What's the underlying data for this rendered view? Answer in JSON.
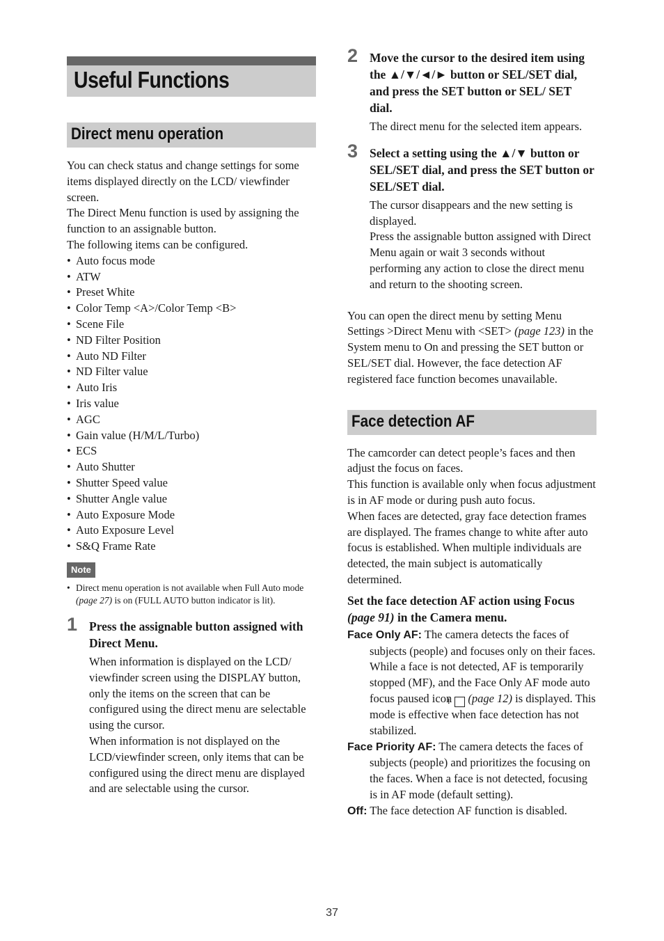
{
  "chapter_title": "Useful Functions",
  "direct_menu": {
    "heading": "Direct menu operation",
    "intro": [
      "You can check status and change settings for some items displayed directly on the LCD/ viewfinder screen.",
      "The Direct Menu function is used by assigning the function to an assignable button.",
      "The following items can be configured."
    ],
    "items": [
      "Auto focus mode",
      "ATW",
      "Preset White",
      "Color Temp <A>/Color Temp <B>",
      "Scene File",
      "ND Filter Position",
      "Auto ND Filter",
      "ND Filter value",
      "Auto Iris",
      "Iris value",
      "AGC",
      "Gain value (H/M/L/Turbo)",
      "ECS",
      "Auto Shutter",
      "Shutter Speed value",
      "Shutter Angle value",
      "Auto Exposure Mode",
      "Auto Exposure Level",
      "S&Q Frame Rate"
    ],
    "note_label": "Note",
    "note": {
      "before": "Direct menu operation is not available when Full Auto mode ",
      "ref": "(page 27)",
      "after": " is on (FULL AUTO button indicator is lit)."
    },
    "steps": [
      {
        "number": "1",
        "title": "Press the assignable button assigned with Direct Menu.",
        "body": [
          "When information is displayed on the LCD/ viewfinder screen using the DISPLAY button, only the items on the screen that can be configured using the direct menu are selectable using the cursor.",
          "When information is not displayed on the LCD/viewfinder screen, only items that can be configured using the direct menu are displayed and are selectable using the cursor."
        ]
      },
      {
        "number": "2",
        "title": "Move the cursor to the desired item using the ▲/▼/◄/► button or SEL/SET dial, and press the SET button or SEL/ SET dial.",
        "body": [
          "The direct menu for the selected item appears."
        ]
      },
      {
        "number": "3",
        "title": "Select a setting using the ▲/▼ button or SEL/SET dial, and press the SET button or SEL/SET dial.",
        "body": [
          "The cursor disappears and the new setting is displayed.",
          "Press the assignable button assigned with Direct Menu again or wait 3 seconds without performing any action to close the direct menu and return to the shooting screen."
        ]
      }
    ],
    "tip": {
      "before": "You can open the direct menu by setting Menu Settings >Direct Menu with <SET> ",
      "ref": "(page 123)",
      "after": " in the System menu to On and pressing the SET button or SEL/SET dial. However, the face detection AF registered face function becomes unavailable."
    }
  },
  "face_af": {
    "heading": "Face detection AF",
    "intro": [
      "The camcorder can detect people’s faces and then adjust the focus on faces.",
      "This function is available only when focus adjustment is in AF mode or during push auto focus.",
      "When faces are detected, gray face detection frames are displayed. The frames change to white after auto focus is established. When multiple individuals are detected, the main subject is automatically determined."
    ],
    "instruction": {
      "before": "Set the face detection AF action using Focus ",
      "ref": "(page 91)",
      "after": " in the Camera menu."
    },
    "options": [
      {
        "term": "Face Only AF:",
        "text_before_icon": " The camera detects the faces of subjects (people) and focuses only on their faces. While a face is not detected, AF is temporarily stopped (MF), and the Face Only AF mode auto focus paused icon",
        "icon_glyph": "!",
        "ref": "(page 12)",
        "text_after": " is displayed. This mode is effective when face detection has not stabilized."
      },
      {
        "term": "Face Priority AF:",
        "text": " The camera detects the faces of subjects (people) and prioritizes the focusing on the faces. When a face is not detected, focusing is in AF mode (default setting)."
      },
      {
        "term": "Off:",
        "text": " The face detection AF function is disabled."
      }
    ]
  },
  "page_number": "37"
}
